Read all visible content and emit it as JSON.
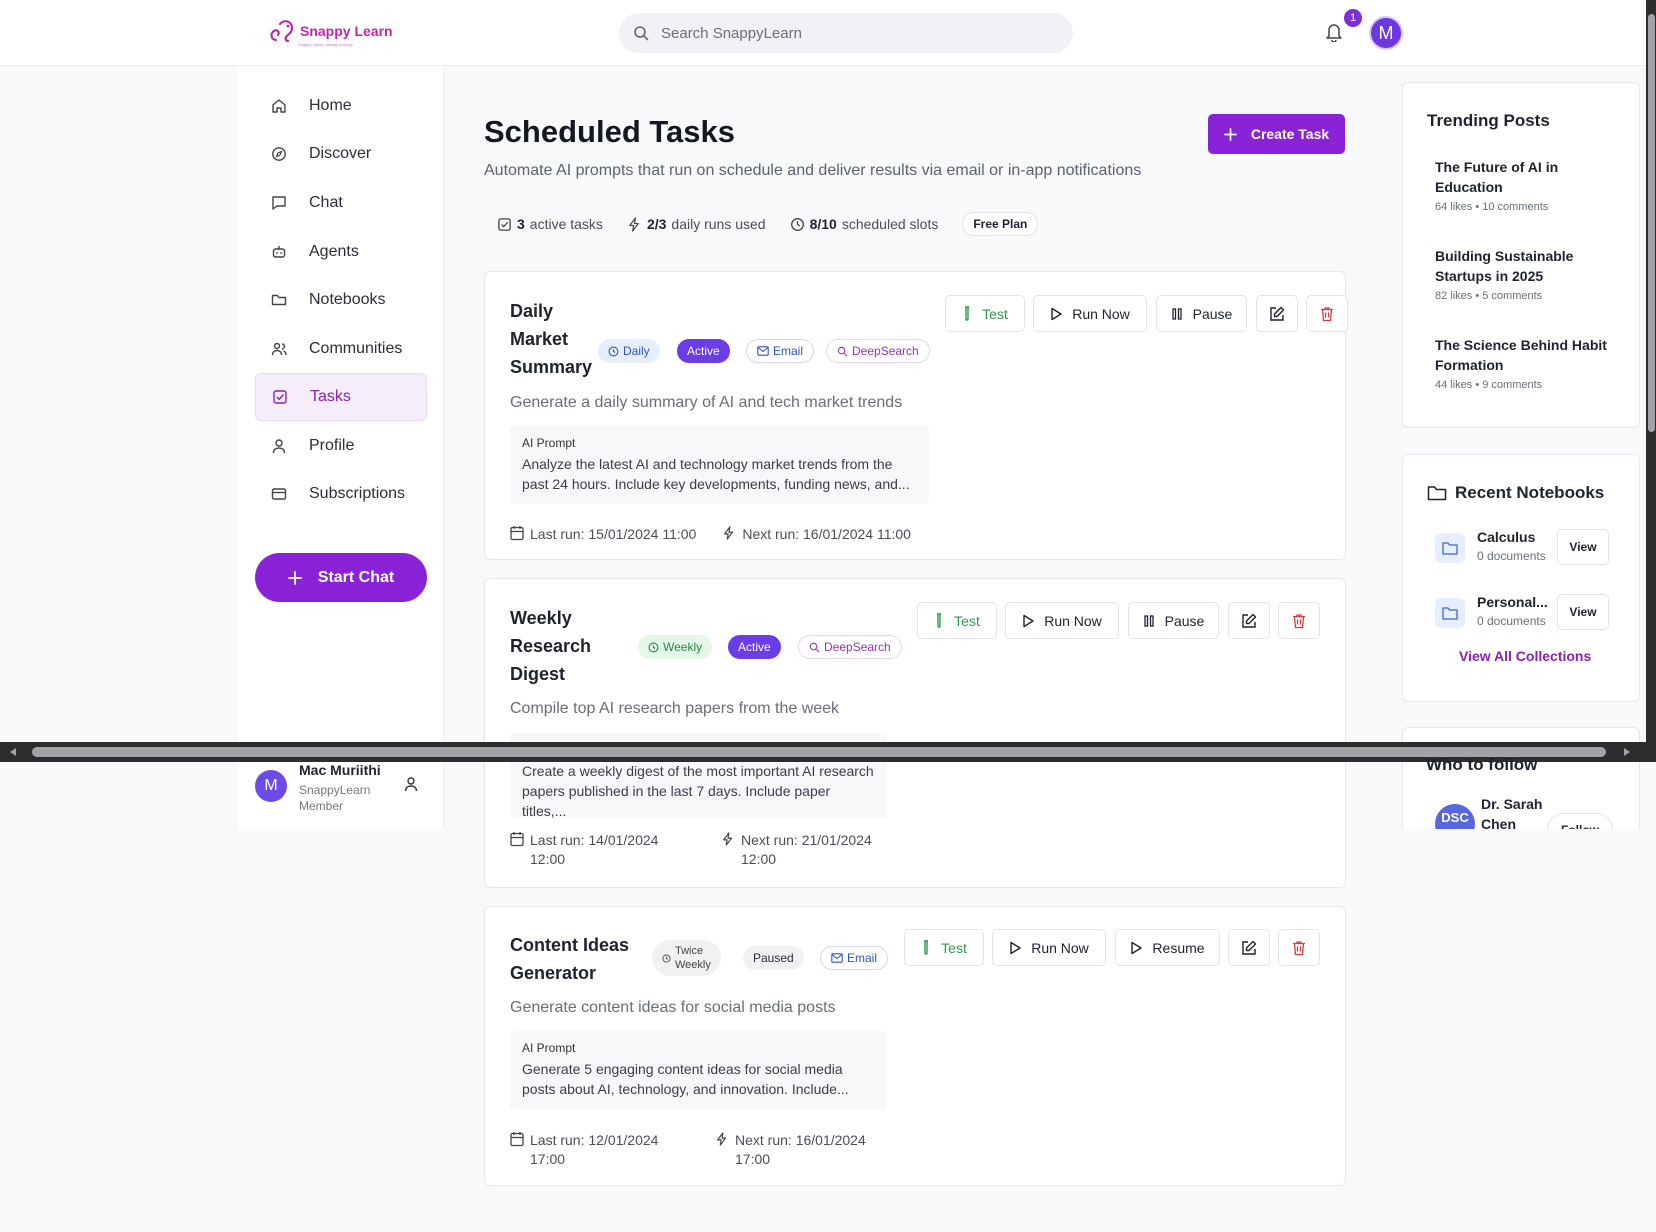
{
  "header": {
    "logo_text": "Snappy Learn",
    "logo_tagline": "Snappy minds, lasting curiosity",
    "search_placeholder": "Search SnappyLearn",
    "notification_count": "1",
    "avatar_initial": "M"
  },
  "sidebar": {
    "items": [
      {
        "label": "Home",
        "icon": "home-icon"
      },
      {
        "label": "Discover",
        "icon": "compass-icon"
      },
      {
        "label": "Chat",
        "icon": "chat-icon"
      },
      {
        "label": "Agents",
        "icon": "bot-icon"
      },
      {
        "label": "Notebooks",
        "icon": "folder-icon"
      },
      {
        "label": "Communities",
        "icon": "users-icon"
      },
      {
        "label": "Tasks",
        "icon": "checkbox-icon",
        "active": true
      },
      {
        "label": "Profile",
        "icon": "user-icon"
      },
      {
        "label": "Subscriptions",
        "icon": "card-icon"
      }
    ],
    "start_chat_label": "Start Chat",
    "user": {
      "initial": "M",
      "name": "Mac Muriithi",
      "role": "SnappyLearn Member"
    }
  },
  "main": {
    "title": "Scheduled Tasks",
    "subtitle": "Automate AI prompts that run on schedule and deliver results via email or in-app notifications",
    "create_label": "Create Task",
    "stats": {
      "active_count": "3",
      "active_label": "active tasks",
      "runs_used": "2/3",
      "runs_label": "daily runs used",
      "slots": "8/10",
      "slots_label": "scheduled slots",
      "plan": "Free Plan"
    },
    "tasks": [
      {
        "title_lines": [
          "Daily",
          "Market",
          "Summary"
        ],
        "frequency": "Daily",
        "status": "Active",
        "email": "Email",
        "deep": "DeepSearch",
        "description": "Generate a daily summary of AI and tech market trends",
        "prompt_label": "AI Prompt",
        "prompt": "Analyze the latest AI and technology market trends from the past 24 hours. Include key developments, funding news, and...",
        "last_run": "Last run: 15/01/2024 11:00",
        "next_run": "Next run: 16/01/2024 11:00",
        "btn_test": "Test",
        "btn_run": "Run Now",
        "btn_toggle": "Pause"
      },
      {
        "title_lines": [
          "Weekly",
          "Research",
          "Digest"
        ],
        "frequency": "Weekly",
        "status": "Active",
        "deep": "DeepSearch",
        "description": "Compile top AI research papers from the week",
        "prompt": "Create a weekly digest of the most important AI research papers published in the last 7 days. Include paper titles,...",
        "last_run": "Last run: 14/01/2024",
        "last_run_time": "12:00",
        "next_run": "Next run: 21/01/2024",
        "next_run_time": "12:00",
        "btn_test": "Test",
        "btn_run": "Run Now",
        "btn_toggle": "Pause"
      },
      {
        "title_lines": [
          "Content Ideas",
          "Generator"
        ],
        "frequency_lines": [
          "Twice",
          "Weekly"
        ],
        "status": "Paused",
        "email": "Email",
        "description": "Generate content ideas for social media posts",
        "prompt_label": "AI Prompt",
        "prompt": "Generate 5 engaging content ideas for social media posts about AI, technology, and innovation. Include...",
        "last_run": "Last run: 12/01/2024",
        "last_run_time": "17:00",
        "next_run": "Next run: 16/01/2024",
        "next_run_time": "17:00",
        "btn_test": "Test",
        "btn_run": "Run Now",
        "btn_toggle": "Resume"
      }
    ]
  },
  "right": {
    "trending_title": "Trending Posts",
    "posts": [
      {
        "title": "The Future of AI in Education",
        "meta": "64 likes • 10 comments"
      },
      {
        "title": "Building Sustainable Startups in 2025",
        "meta": "82 likes • 5 comments"
      },
      {
        "title": "The Science Behind Habit Formation",
        "meta": "44 likes • 9 comments"
      }
    ],
    "notebooks_title": "Recent Notebooks",
    "notebooks": [
      {
        "name": "Calculus",
        "count": "0 documents",
        "view": "View"
      },
      {
        "name": "Personal...",
        "count": "0 documents",
        "view": "View"
      }
    ],
    "view_all": "View All Collections",
    "follow_title": "Who to follow",
    "follow_user": {
      "initials": "DSC",
      "name_lines": [
        "Dr. Sarah",
        "Chen"
      ],
      "follow": "Follow"
    }
  },
  "colors": {
    "accent": "#8a22d8",
    "active_badge": "#6a3de8",
    "test_green": "#2e9a4e",
    "delete_red": "#d83a3a"
  }
}
